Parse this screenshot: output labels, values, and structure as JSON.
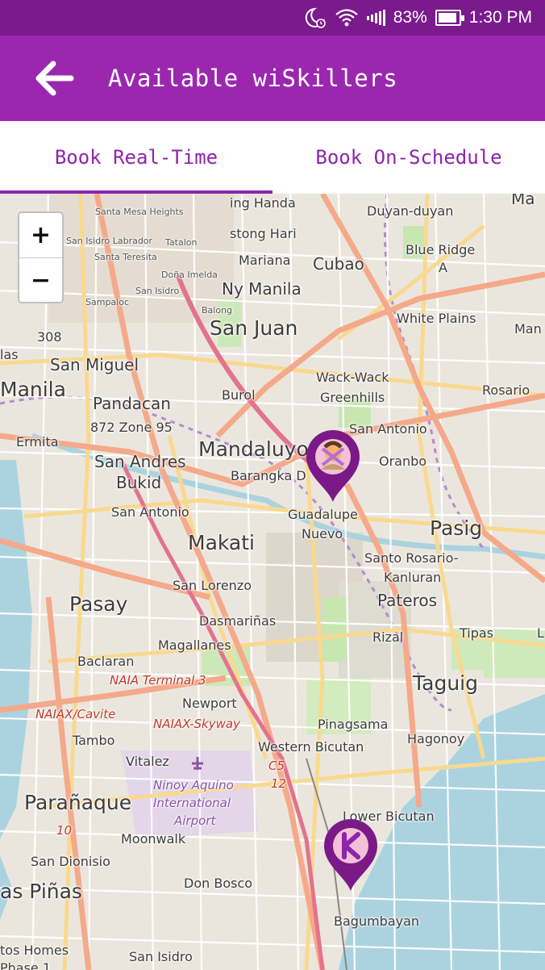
{
  "status_bar": {
    "battery": "83%",
    "time": "1:30 PM"
  },
  "app_bar": {
    "title": "Available wiSkillers"
  },
  "tabs": [
    {
      "label": "Book Real-Time",
      "active": true
    },
    {
      "label": "Book On-Schedule",
      "active": false
    }
  ],
  "map": {
    "zoom_in": "+",
    "zoom_out": "−",
    "labels": {
      "santa_mesa_heights": "Santa Mesa Heights",
      "ing_handa": "ing Handa",
      "duyan_duyan": "Duyan-duyan",
      "ma": "Ma",
      "san_isidro_labrador": "San Isidro Labrador",
      "tatalon": "Tatalon",
      "stong_hari": "stong Hari",
      "blue_ridge": "Blue Ridge",
      "blue_ridge_a": "A",
      "santa_teresita": "Santa Teresita",
      "mariana": "Mariana",
      "cubao": "Cubao",
      "dona_imelda": "Doña Imelda",
      "ny_manila": "Ny Manila",
      "san_isidro_top": "San Isidro",
      "sampaloc": "Sampaloc",
      "balong": "Balong",
      "white_plains": "White Plains",
      "man": "Man",
      "n308": "308",
      "san_juan": "San Juan",
      "las": "las",
      "san_miguel": "San Miguel",
      "wack_wack": "Wack-Wack",
      "greenhills": "Greenhills",
      "rosario": "Rosario",
      "manila": "Manila",
      "pandacan": "Pandacan",
      "burol": "Burol",
      "zone95": "872 Zone 95",
      "san_antonio_e": "San Antonio",
      "ermita": "Ermita",
      "mandaluyong": "Mandaluyo",
      "oranbo": "Oranbo",
      "san_andres": "San Andres",
      "bukid": "Bukid",
      "barangka": "Barangka D",
      "san_antonio_w": "San Antonio",
      "guadalupe": "Guadalupe",
      "nuevo": "Nuevo",
      "pasig": "Pasig",
      "makati": "Makati",
      "santo_rosario": "Santo Rosario-",
      "kanluran": "Kanluran",
      "san_lorenzo": "San Lorenzo",
      "pateros": "Pateros",
      "pasay": "Pasay",
      "dasmarinas": "Dasmariñas",
      "rizal": "Rizal",
      "tipas": "Tipas",
      "l": "L",
      "magallanes": "Magallanes",
      "baclaran": "Baclaran",
      "naia_t3": "NAIA Terminal 3",
      "taguig": "Taguig",
      "newport": "Newport",
      "naiax_cavite": "NAIAX/Cavite",
      "naiax_skyway": "NAIAX-Skyway",
      "pinagsama": "Pinagsama",
      "tambo": "Tambo",
      "hagonoy": "Hagonoy",
      "western_bicutan": "Western Bicutan",
      "vitalez": "Vitalez",
      "c5": "C5",
      "n12": "12",
      "ninoy": "Ninoy Aquino",
      "international": "International",
      "airport": "Airport",
      "paranaque": "Parañaque",
      "lower_bicutan": "Lower Bicutan",
      "n10": "10",
      "moonwalk": "Moonwalk",
      "san_dionisio": "San Dionisio",
      "las_pinas": "as Piñas",
      "don_bosco": "Don Bosco",
      "bagumbayan": "Bagumbayan",
      "tos_homes": "tos Homes",
      "phase1": "Phase 1",
      "san_isidro_bottom": "San Isidro"
    },
    "colors": {
      "water": "#aad3df",
      "major_road": "#f4a98a",
      "secondary_road": "#f8d98e",
      "marker": "#7b1a86"
    }
  }
}
